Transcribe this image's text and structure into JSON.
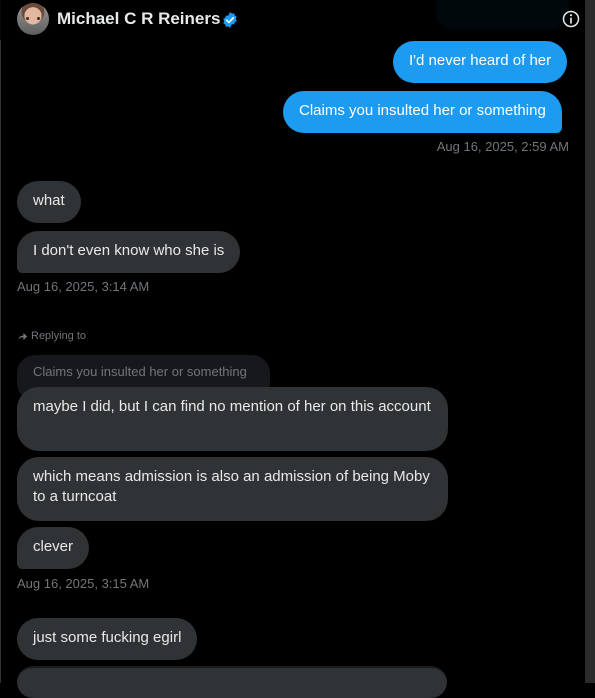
{
  "header": {
    "name": "Michael C R Reiners"
  },
  "messages": [
    {
      "id": "m1",
      "dir": "out",
      "text": "I'd never heard of her"
    },
    {
      "id": "m2",
      "dir": "out",
      "text": "Claims you insulted her or something"
    },
    {
      "id": "m3",
      "dir": "in",
      "text": "what"
    },
    {
      "id": "m4",
      "dir": "in",
      "text": "I don't even know who she is"
    },
    {
      "id": "m5",
      "dir": "in",
      "text": "maybe I did, but I can find no mention of her on this account"
    },
    {
      "id": "m6",
      "dir": "in",
      "text": "which means admission is also an admission of being Moby to a turncoat"
    },
    {
      "id": "m7",
      "dir": "in",
      "text": "clever"
    },
    {
      "id": "m8",
      "dir": "in",
      "text": "just some fucking egirl"
    }
  ],
  "timestamps": {
    "t1": "Aug 16, 2025, 2:59 AM",
    "t2": "Aug 16, 2025, 3:14 AM",
    "t3": "Aug 16, 2025, 3:15 AM"
  },
  "reply": {
    "label": "Replying to",
    "quoted": "Claims you insulted her or something"
  },
  "icons": {
    "verified": "verified-badge-icon",
    "info": "info-icon",
    "reply": "reply-arrow-icon"
  },
  "colors": {
    "outgoing": "#1d9bf0",
    "incoming": "#2f3336",
    "muted": "#71767b",
    "background": "#000000"
  }
}
